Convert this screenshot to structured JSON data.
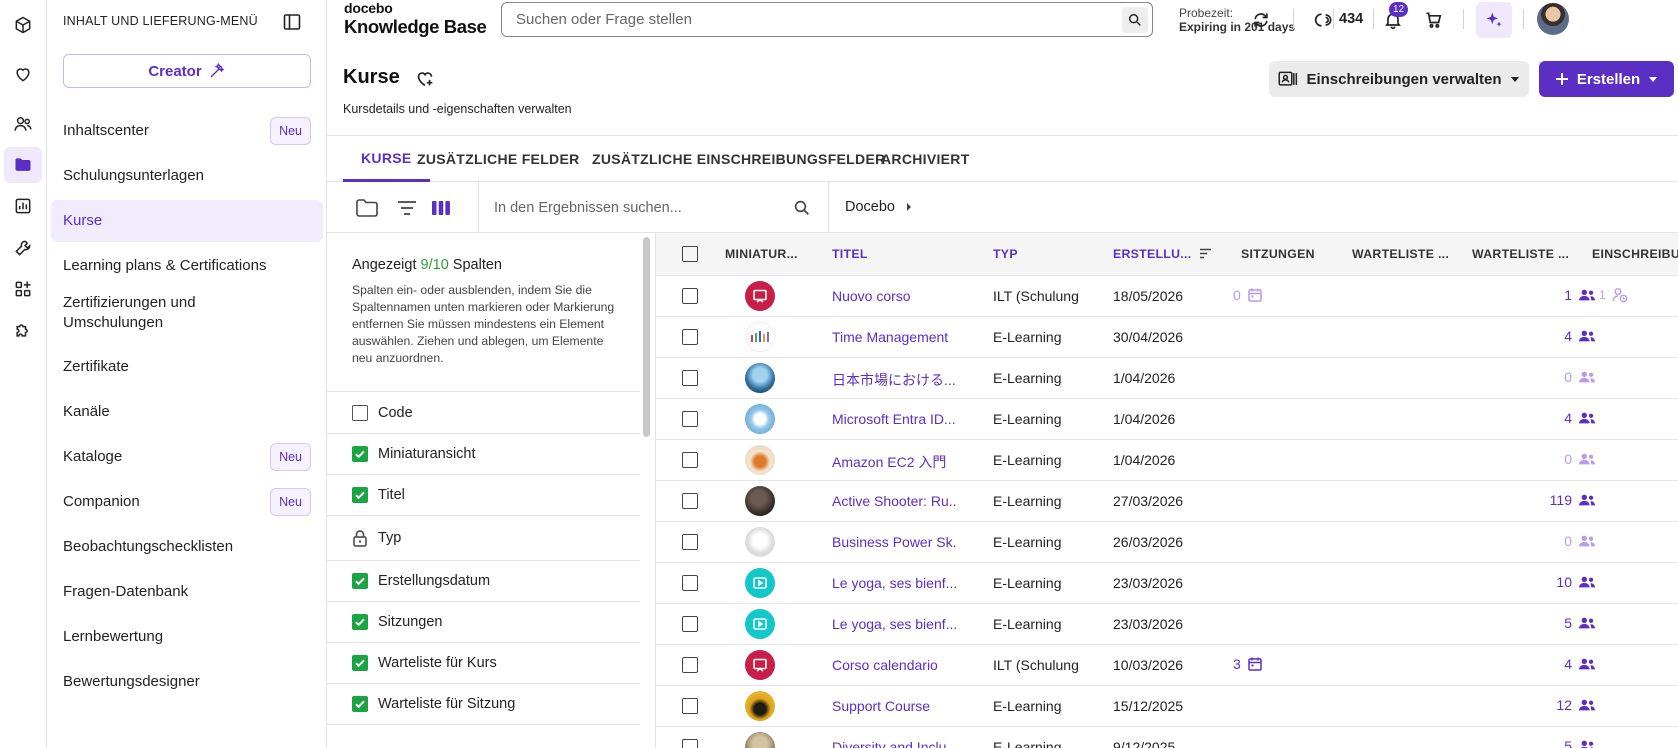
{
  "colors": {
    "accent": "#5b2fc4",
    "accent_light": "#b79cee",
    "check_green": "#1aa442",
    "shown_green": "#2ea03a"
  },
  "header": {
    "logo_small": "docebo",
    "logo_big": "Knowledge Base",
    "search_placeholder": "Suchen oder Frage stellen",
    "trial_label": "Probezeit:",
    "trial_value": "Expiring in 201 days",
    "credits": "434",
    "notifications": "12"
  },
  "menu": {
    "title": "INHALT UND LIEFERUNG-MENÜ",
    "creator_label": "Creator",
    "new_badge": "Neu",
    "items": [
      {
        "label": "Inhaltscenter",
        "badge": true
      },
      {
        "label": "Schulungsunterlagen",
        "badge": false
      },
      {
        "label": "Kurse",
        "badge": false,
        "active": true
      },
      {
        "label": "Learning plans & Certifications",
        "badge": false
      },
      {
        "label": "Zertifizierungen und Umschulungen",
        "badge": false
      },
      {
        "label": "Zertifikate",
        "badge": false
      },
      {
        "label": "Kanäle",
        "badge": false
      },
      {
        "label": "Kataloge",
        "badge": true
      },
      {
        "label": "Companion",
        "badge": true
      },
      {
        "label": "Beobachtungschecklisten",
        "badge": false
      },
      {
        "label": "Fragen-Datenbank",
        "badge": false
      },
      {
        "label": "Lernbewertung",
        "badge": false
      },
      {
        "label": "Bewertungsdesigner",
        "badge": false
      }
    ]
  },
  "page": {
    "title": "Kurse",
    "subtitle": "Kursdetails und -eigenschaften verwalten",
    "enroll_button": "Einschreibungen verwalten",
    "create_button": "Erstellen"
  },
  "tabs": [
    "KURSE",
    "ZUSÄTZLICHE FELDER",
    "ZUSÄTZLICHE EINSCHREIBUNGSFELDER",
    "ARCHIVIERT"
  ],
  "toolbar": {
    "search_placeholder": "In den Ergebnissen suchen...",
    "breadcrumb": "Docebo"
  },
  "columns_panel": {
    "shown_prefix": "Angezeigt",
    "shown_count": "9/10",
    "shown_suffix": "Spalten",
    "help": "Spalten ein- oder ausblenden, indem Sie die Spaltennamen unten markieren oder Markierung entfernen Sie müssen mindestens ein Element auswählen. Ziehen und ablegen, um Elemente neu anzuordnen.",
    "items": [
      {
        "label": "Code",
        "state": "off"
      },
      {
        "label": "Miniaturansicht",
        "state": "on"
      },
      {
        "label": "Titel",
        "state": "on"
      },
      {
        "label": "Typ",
        "state": "locked"
      },
      {
        "label": "Erstellungsdatum",
        "state": "on"
      },
      {
        "label": "Sitzungen",
        "state": "on"
      },
      {
        "label": "Warteliste für Kurs",
        "state": "on"
      },
      {
        "label": "Warteliste für Sitzung",
        "state": "on"
      }
    ]
  },
  "table": {
    "headers": [
      "MINIATUR...",
      "TITEL",
      "TYP",
      "ERSTELLU...",
      "SITZUNGEN",
      "WARTELISTE ...",
      "WARTELISTE ...",
      "EINSCHREIBU..."
    ],
    "rows": [
      {
        "thumb": "red",
        "title": "Nuovo corso",
        "type": "ILT (Schulung",
        "date": "18/05/2026",
        "sessions": "0",
        "sessions_light": true,
        "enrollments": "1",
        "enr_light": false,
        "extra": "1"
      },
      {
        "thumb": "white",
        "title": "Time Management",
        "type": "E-Learning",
        "date": "30/04/2026",
        "sessions": "",
        "enrollments": "4",
        "enr_light": false
      },
      {
        "thumb": "blue",
        "title": "日本市場における...",
        "type": "E-Learning",
        "date": "1/04/2026",
        "sessions": "",
        "enrollments": "0",
        "enr_light": true
      },
      {
        "thumb": "cloud",
        "title": "Microsoft Entra ID...",
        "type": "E-Learning",
        "date": "1/04/2026",
        "sessions": "",
        "enrollments": "4",
        "enr_light": false
      },
      {
        "thumb": "orange",
        "title": "Amazon EC2 入門",
        "type": "E-Learning",
        "date": "1/04/2026",
        "sessions": "",
        "enrollments": "0",
        "enr_light": true
      },
      {
        "thumb": "dark",
        "title": "Active Shooter: Ru...",
        "type": "E-Learning",
        "date": "27/03/2026",
        "sessions": "",
        "enrollments": "119",
        "enr_light": false
      },
      {
        "thumb": "grey",
        "title": "Business Power Sk...",
        "type": "E-Learning",
        "date": "26/03/2026",
        "sessions": "",
        "enrollments": "0",
        "enr_light": true
      },
      {
        "thumb": "teal",
        "title": "Le yoga, ses bienf...",
        "type": "E-Learning",
        "date": "23/03/2026",
        "sessions": "",
        "enrollments": "10",
        "enr_light": false
      },
      {
        "thumb": "teal",
        "title": "Le yoga, ses bienf...",
        "type": "E-Learning",
        "date": "23/03/2026",
        "sessions": "",
        "enrollments": "5",
        "enr_light": false
      },
      {
        "thumb": "red",
        "title": "Corso calendario",
        "type": "ILT (Schulung",
        "date": "10/03/2026",
        "sessions": "3",
        "sessions_light": false,
        "enrollments": "4",
        "enr_light": false
      },
      {
        "thumb": "yellow",
        "title": "Support Course",
        "type": "E-Learning",
        "date": "15/12/2025",
        "sessions": "",
        "enrollments": "12",
        "enr_light": false
      },
      {
        "thumb": "brown",
        "title": "Diversity and Inclu...",
        "type": "E-Learning",
        "date": "9/12/2025",
        "sessions": "",
        "enrollments": "5",
        "enr_light": false
      }
    ]
  }
}
